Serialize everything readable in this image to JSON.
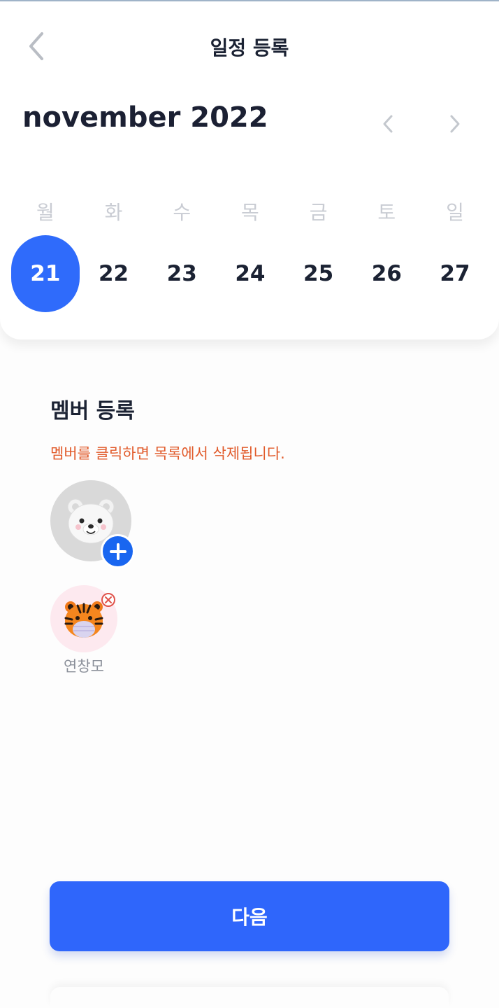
{
  "header": {
    "title": "일정 등록",
    "back_icon": "chevron-left-icon"
  },
  "calendar": {
    "month_label": "november 2022",
    "prev_icon": "chevron-left-icon",
    "next_icon": "chevron-right-icon",
    "weekdays": [
      "월",
      "화",
      "수",
      "목",
      "금",
      "토",
      "일"
    ],
    "dates": [
      "21",
      "22",
      "23",
      "24",
      "25",
      "26",
      "27"
    ],
    "selected_date": "21",
    "accent_color": "#2f6bfb"
  },
  "members": {
    "title": "멤버 등록",
    "note": "멤버를 클릭하면 목록에서 삭제됩니다.",
    "note_color": "#e15a2a",
    "add_icon": "polar-bear-avatar-icon",
    "list": [
      {
        "name": "연창모",
        "avatar": "tiger-avatar-icon"
      }
    ]
  },
  "footer": {
    "next_label": "다음"
  }
}
